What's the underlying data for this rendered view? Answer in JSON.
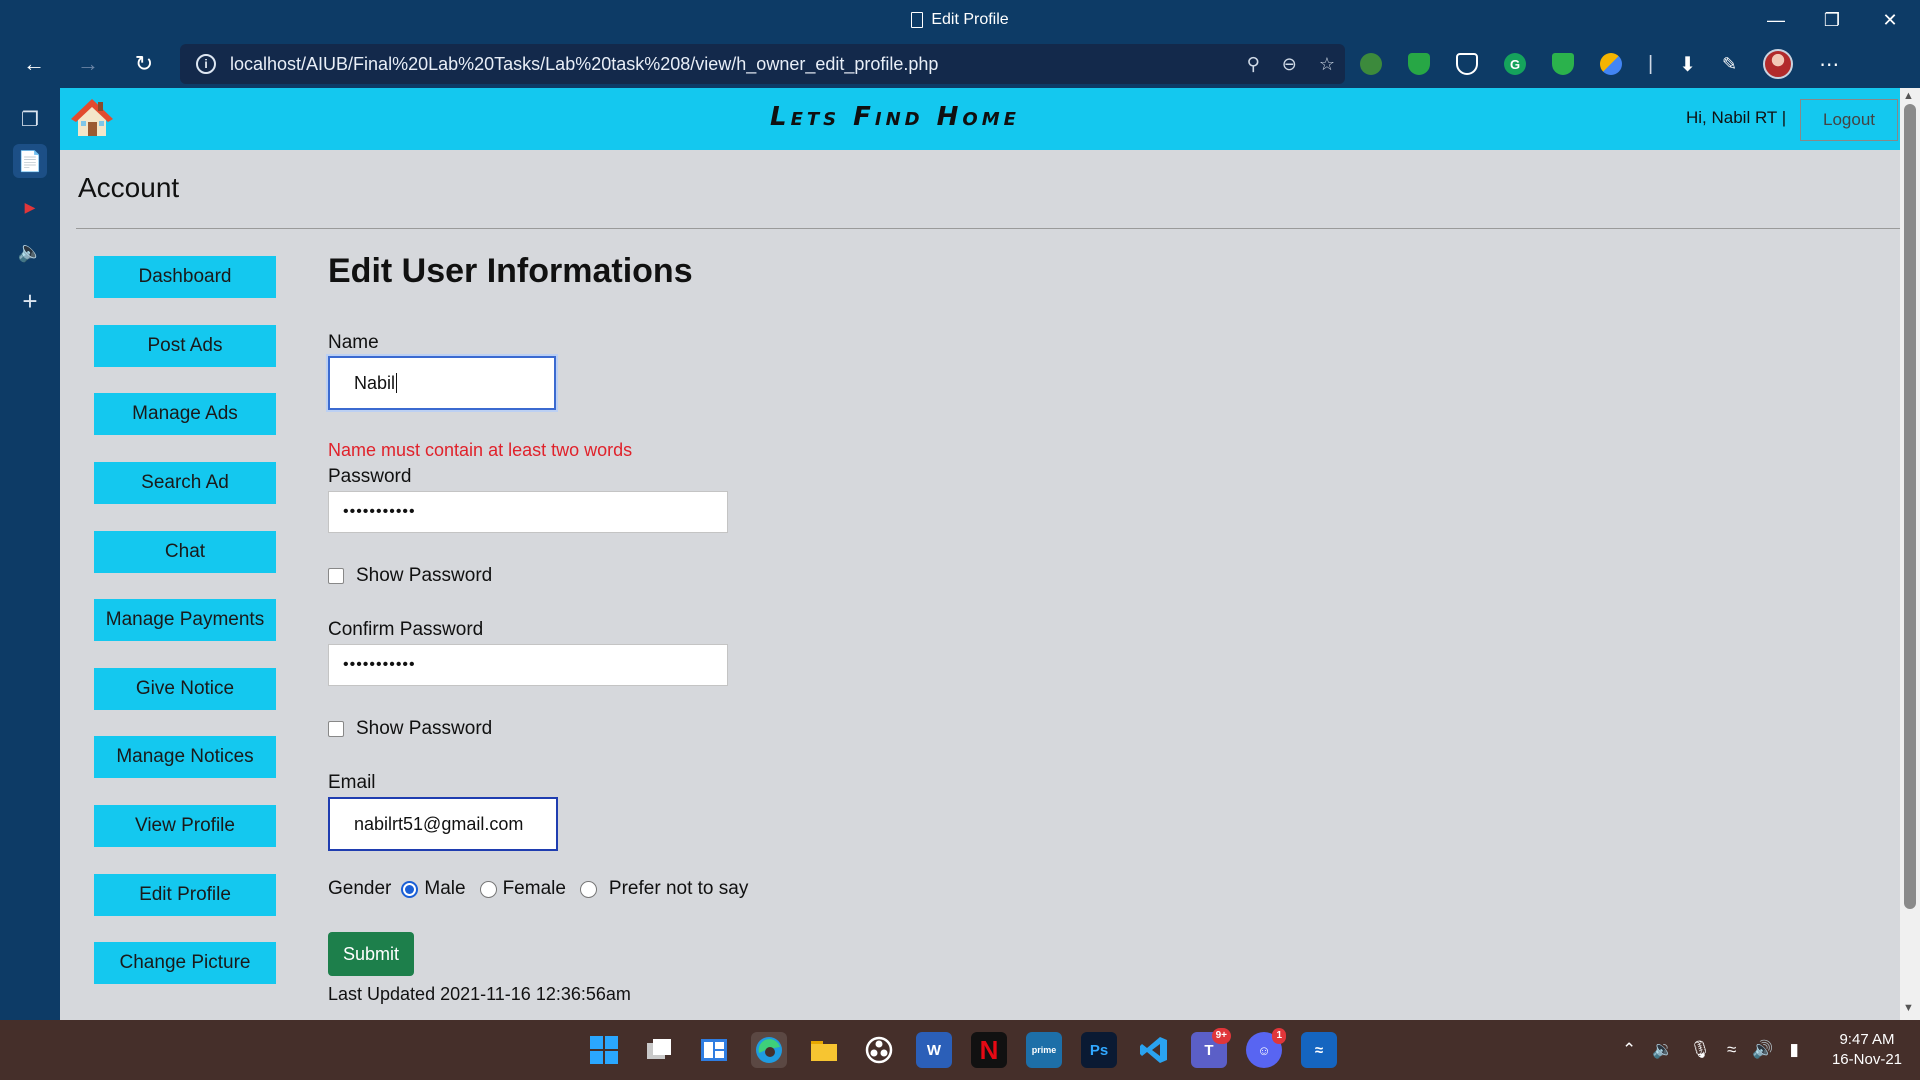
{
  "window": {
    "title": "Edit Profile"
  },
  "browser": {
    "url": "localhost/AIUB/Final%20Lab%20Tasks/Lab%20task%208/view/h_owner_edit_profile.php"
  },
  "header": {
    "brand": "Lets Find Home",
    "greeting": "Hi, Nabil RT  |",
    "logout_label": "Logout"
  },
  "section_title": "Account",
  "menu": [
    "Dashboard",
    "Post Ads",
    "Manage Ads",
    "Search Ad",
    "Chat",
    "Manage Payments",
    "Give Notice",
    "Manage Notices",
    "View Profile",
    "Edit Profile",
    "Change Picture"
  ],
  "form": {
    "title": "Edit User Informations",
    "name_label": "Name",
    "name_value": "Nabil",
    "name_error": "Name must contain at least two words",
    "password_label": "Password",
    "password_value": "•••••••••••",
    "show_password_label": "Show Password",
    "confirm_label": "Confirm Password",
    "confirm_value": "•••••••••••",
    "show_confirm_label": "Show Password",
    "email_label": "Email",
    "email_value": "nabilrt51@gmail.com",
    "gender_label": "Gender",
    "gender_options": [
      "Male",
      "Female",
      "Prefer not to say"
    ],
    "gender_selected": "Male",
    "submit_label": "Submit",
    "last_updated": "Last Updated 2021-11-16 12:36:56am"
  },
  "taskbar": {
    "teams_badge": "9+",
    "discord_badge": "1",
    "time": "9:47 AM",
    "date": "16-Nov-21"
  },
  "colors": {
    "chrome": "#0d3b66",
    "header_accent": "#14c8ef",
    "error": "#e0222b",
    "submit": "#1d7f4b"
  }
}
